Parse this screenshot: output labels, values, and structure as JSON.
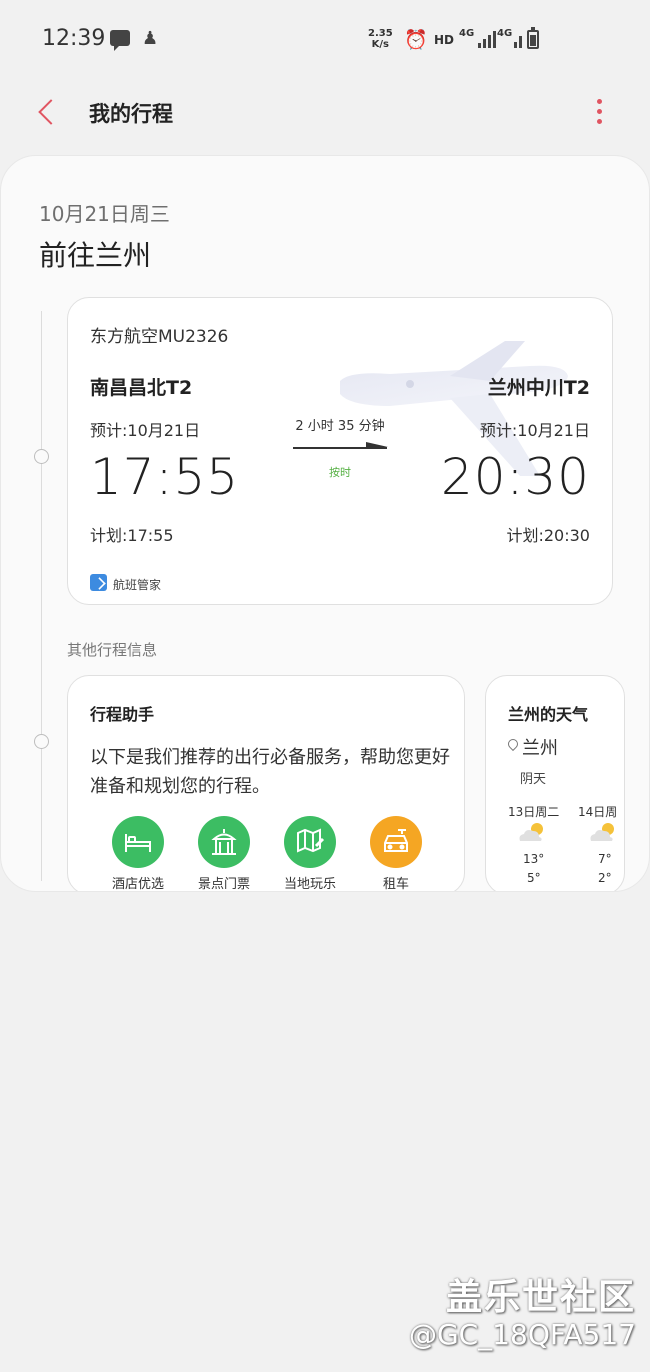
{
  "status_bar": {
    "time": "12:39",
    "net_speed_value": "2.35",
    "net_speed_unit": "K/s",
    "hd": "HD",
    "sim1": "4G",
    "sim2": "4G"
  },
  "app_bar": {
    "title": "我的行程"
  },
  "trip": {
    "date": "10月21日周三",
    "destination": "前往兰州"
  },
  "flight": {
    "airline": "东方航空MU2326",
    "departure_airport": "南昌昌北T2",
    "arrival_airport": "兰州中川T2",
    "departure_date": "预计:10月21日",
    "arrival_date": "预计:10月21日",
    "duration": "2 小时 35 分钟",
    "status": "按时",
    "departure_time": "17:55",
    "arrival_time": "20:30",
    "departure_planned": "计划:17:55",
    "arrival_planned": "计划:20:30",
    "source": "航班管家"
  },
  "other_info_title": "其他行程信息",
  "assistant": {
    "title": "行程助手",
    "description": "以下是我们推荐的出行必备服务，帮助您更好准备和规划您的行程。",
    "services": [
      {
        "label": "酒店优选",
        "icon": "hotel-icon",
        "color": "#3cbd63"
      },
      {
        "label": "景点门票",
        "icon": "attraction-icon",
        "color": "#3cbd63"
      },
      {
        "label": "当地玩乐",
        "icon": "map-icon",
        "color": "#3cbd63"
      },
      {
        "label": "租车",
        "icon": "car-icon",
        "color": "#f5a623"
      }
    ]
  },
  "weather": {
    "title": "兰州的天气",
    "city": "兰州",
    "condition": "阴天",
    "days": [
      {
        "label": "13日周二",
        "high": "13°",
        "low": "5°",
        "icon": "partly-cloudy-icon"
      },
      {
        "label": "14日周",
        "high": "7°",
        "low": "2°",
        "icon": "partly-cloudy-icon"
      }
    ]
  },
  "watermark": {
    "title": "盖乐世社区",
    "user": "@GC_18QFA517"
  },
  "colors": {
    "accent": "#e05561",
    "green": "#3cbd63",
    "orange": "#f5a623",
    "ontime": "#55b043"
  }
}
